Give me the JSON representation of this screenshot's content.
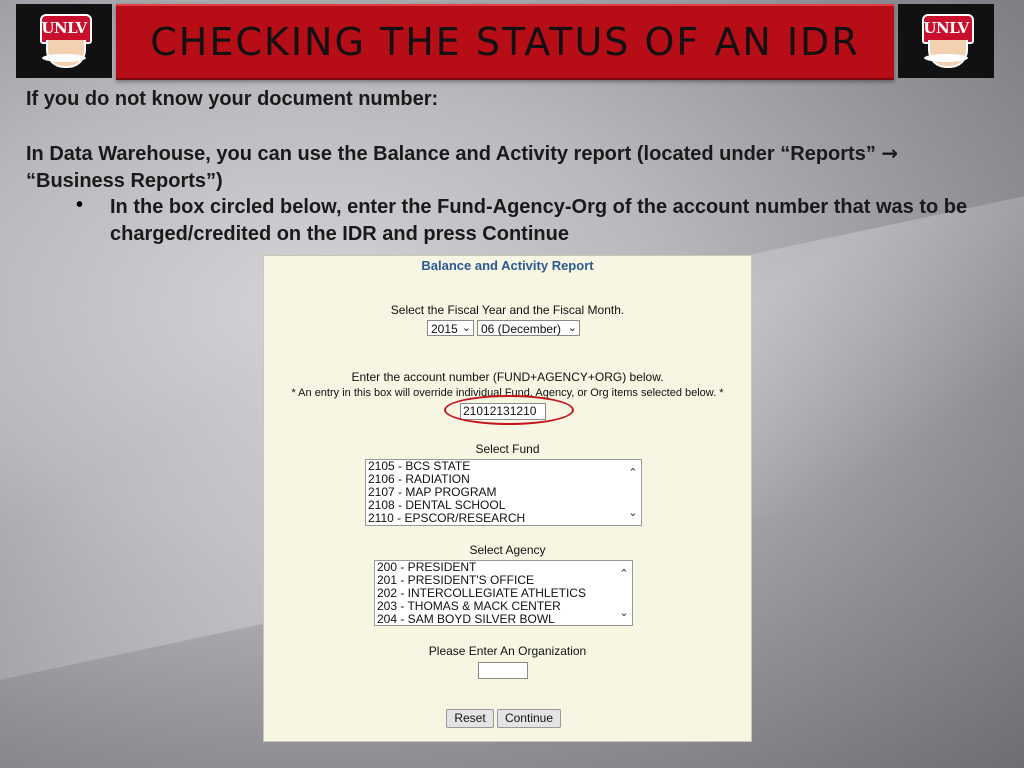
{
  "header": {
    "title": "CHECKING THE STATUS OF AN IDR",
    "logo_text": "UNLV"
  },
  "instructions": {
    "line1": "If you do not know your document number:",
    "line2_part1": "In Data Warehouse, you can use the Balance and Activity report (located under “Reports” ",
    "arrow": "→",
    "line2_part2": " “Business Reports”)",
    "bullet": "•",
    "bullet_text": "In the box circled below, enter the Fund-Agency-Org of the account number that was to be charged/credited on the IDR and press Continue"
  },
  "report": {
    "title": "Balance and Activity Report",
    "fiscal_label": "Select the Fiscal Year and the Fiscal Month.",
    "year": "2015",
    "month": "06  (December)",
    "account_label": "Enter the account number (FUND+AGENCY+ORG) below.",
    "account_note": "* An entry in this box will override individual Fund, Agency, or Org items selected below. *",
    "account_value": "21012131210",
    "fund_label": "Select Fund",
    "funds": [
      "2105 - BCS STATE",
      "2106 - RADIATION",
      "2107 - MAP PROGRAM",
      "2108 - DENTAL SCHOOL",
      "2110 - EPSCOR/RESEARCH"
    ],
    "agency_label": "Select Agency",
    "agencies": [
      "200 - PRESIDENT",
      "201 - PRESIDENT'S OFFICE",
      "202 - INTERCOLLEGIATE ATHLETICS",
      "203 - THOMAS & MACK CENTER",
      "204 - SAM BOYD SILVER BOWL"
    ],
    "org_label": "Please Enter An Organization",
    "org_value": "",
    "reset_label": "Reset",
    "continue_label": "Continue"
  },
  "colors": {
    "title_bar": "#b70d17",
    "panel_bg": "#f6f6e3",
    "panel_title": "#2b5a93",
    "circle": "#c4141e"
  }
}
